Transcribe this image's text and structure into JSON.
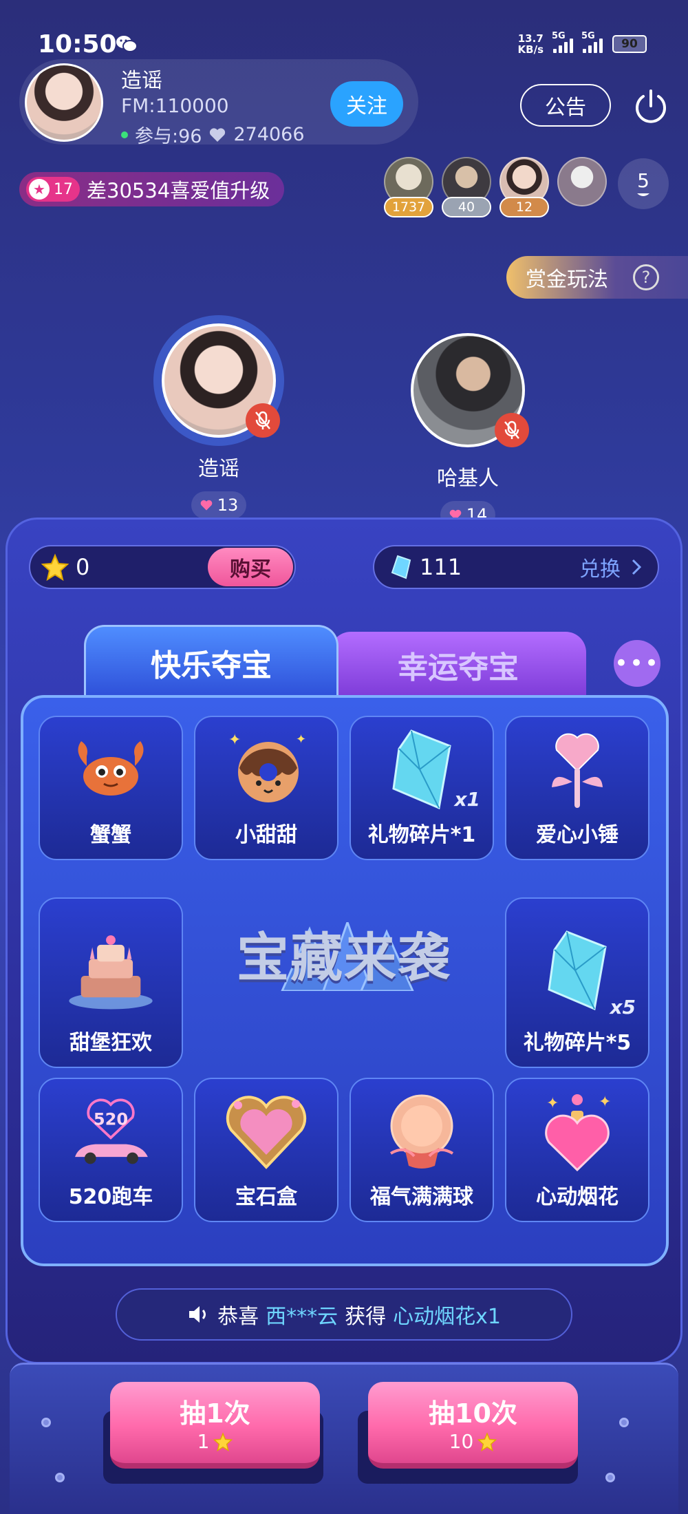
{
  "status_bar": {
    "time": "10:50",
    "net_speed_value": "13.7",
    "net_speed_unit": "KB/s",
    "signal1_label": "5G",
    "signal2_label": "5G",
    "battery": "90"
  },
  "room": {
    "name": "造谣",
    "fm": "FM:110000",
    "participants": "参与:96",
    "likes": "274066",
    "follow_label": "关注",
    "notice_label": "公告"
  },
  "level": {
    "badge": "17",
    "text": "差30534喜爱值升级"
  },
  "top_users": [
    {
      "count": "1737",
      "color": "#e2a23b"
    },
    {
      "count": "40",
      "color": "#9aa3b2"
    },
    {
      "count": "12",
      "color": "#d28a4a"
    }
  ],
  "online_count": "5",
  "bounty_label": "赏金玩法",
  "seats": [
    {
      "name": "造谣",
      "hearts": "13"
    },
    {
      "name": "哈基人",
      "hearts": "14"
    }
  ],
  "balance": {
    "stars": "0",
    "buy_label": "购买",
    "gems": "111",
    "exchange_label": "兑换"
  },
  "tabs": {
    "active": "快乐夺宝",
    "inactive": "幸运夺宝"
  },
  "prizes": [
    {
      "name": "蟹蟹",
      "icon": "crab-icon"
    },
    {
      "name": "小甜甜",
      "icon": "donut-icon"
    },
    {
      "name": "礼物碎片*1",
      "icon": "crystal-icon",
      "qty": "x1"
    },
    {
      "name": "爱心小锤",
      "icon": "heart-hammer-icon"
    },
    {
      "name": "甜堡狂欢",
      "icon": "castle-cake-icon"
    },
    {
      "name": "礼物碎片*5",
      "icon": "crystal-icon",
      "qty": "x5"
    },
    {
      "name": "520跑车",
      "icon": "sports-car-icon",
      "label": "520"
    },
    {
      "name": "宝石盒",
      "icon": "gem-box-icon"
    },
    {
      "name": "福气满满球",
      "icon": "fortune-ball-icon"
    },
    {
      "name": "心动烟花",
      "icon": "heart-firework-icon"
    }
  ],
  "center_title": "宝藏来袭",
  "winner": {
    "prefix": "恭喜",
    "user": "西***云",
    "verb": "获得",
    "item": "心动烟花x1"
  },
  "draw": {
    "once_label": "抽1次",
    "once_cost": "1",
    "ten_label": "抽10次",
    "ten_cost": "10"
  },
  "colors": {
    "accent_blue": "#2aa3ff",
    "pink": "#f0569b",
    "cyan": "#6fd6ff"
  }
}
